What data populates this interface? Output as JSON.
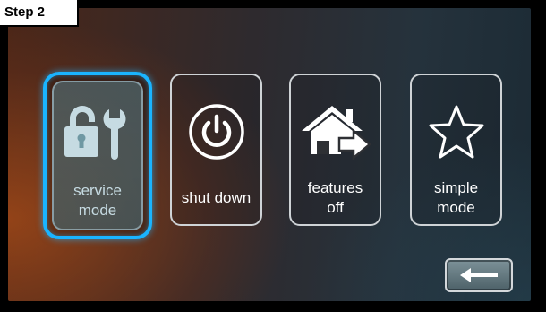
{
  "step_label": "Step 2",
  "menu": {
    "items": [
      {
        "lines": [
          "service",
          "mode"
        ],
        "icon": "lock-wrench-icon",
        "selected": true
      },
      {
        "lines": [
          "shut down"
        ],
        "icon": "power-icon",
        "selected": false
      },
      {
        "lines": [
          "features",
          "off"
        ],
        "icon": "house-arrow-icon",
        "selected": false
      },
      {
        "lines": [
          "simple",
          "mode"
        ],
        "icon": "star-icon",
        "selected": false
      }
    ]
  },
  "back_button": {
    "icon": "left-arrow-icon"
  },
  "colors": {
    "selection_glow": "#1ab4ff",
    "tile_border": "#cfd3d6",
    "text": "#ffffff"
  }
}
